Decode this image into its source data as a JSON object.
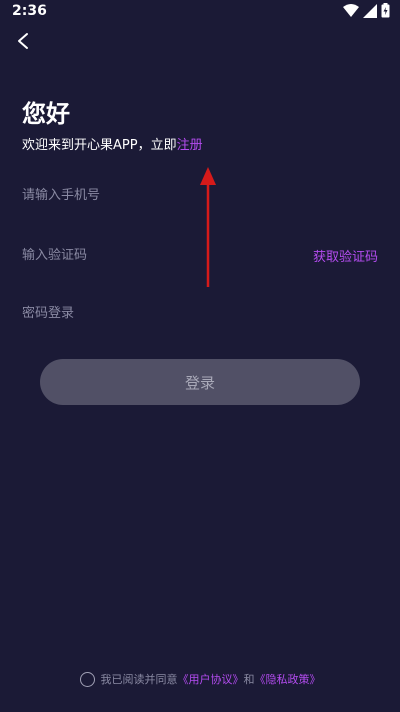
{
  "status_bar": {
    "time": "2:36",
    "icons": [
      "wifi-icon",
      "signal-icon",
      "battery-icon"
    ]
  },
  "header": {
    "back_icon": "chevron-left-icon"
  },
  "main": {
    "title": "您好",
    "subtitle_prefix": "欢迎来到开心果APP，立即",
    "register_link": "注册",
    "phone_placeholder": "请输入手机号",
    "code_placeholder": "输入验证码",
    "get_code_label": "获取验证码",
    "password_login_label": "密码登录",
    "login_button_label": "登录"
  },
  "agreement": {
    "prefix": "我已阅读并同意",
    "user_agreement": "《用户协议》",
    "conjunction": "和",
    "privacy_policy": "《隐私政策》"
  },
  "colors": {
    "background": "#1b1a36",
    "accent": "#b44cf0",
    "button_bg": "#515066",
    "placeholder": "#8a8aa3",
    "annotation_arrow": "#d61a1a"
  }
}
